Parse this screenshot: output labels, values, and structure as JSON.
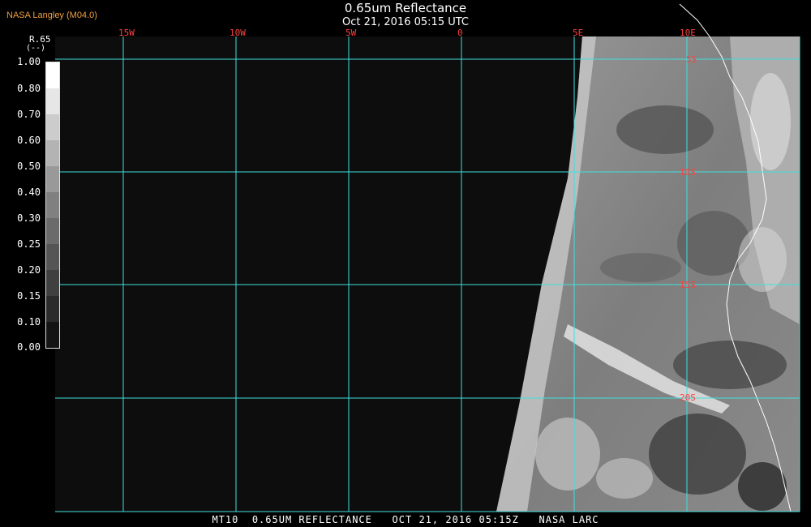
{
  "header": {
    "credit": "NASA Langley (M04.0)",
    "title": "0.65um Reflectance",
    "subtitle": "Oct 21, 2016 05:15 UTC"
  },
  "footer": {
    "caption": "MT10  0.65UM REFLECTANCE   OCT 21, 2016 05:15Z   NASA LARC"
  },
  "map": {
    "lon_labels": [
      "15W",
      "10W",
      "5W",
      "0",
      "5E",
      "10E"
    ],
    "lat_labels": [
      "5S",
      "10S",
      "15S",
      "20S"
    ],
    "grid_color": "#40e0e0",
    "label_color": "#ff4040",
    "background": "#0d0d0d"
  },
  "colorbar": {
    "variable": "R.65",
    "unit": "(--)",
    "ticks": [
      "1.00",
      "0.80",
      "0.70",
      "0.60",
      "0.50",
      "0.40",
      "0.30",
      "0.25",
      "0.20",
      "0.15",
      "0.10",
      "0.00"
    ]
  }
}
